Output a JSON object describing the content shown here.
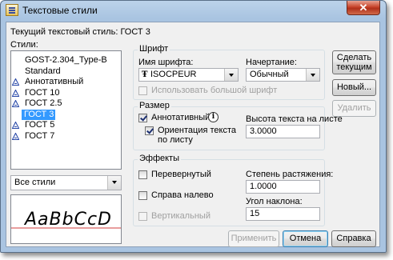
{
  "window": {
    "title": "Текстовые стили",
    "close_glyph": "✕"
  },
  "current_style": {
    "label": "Текущий текстовый стиль:",
    "value": "ГОСТ 3"
  },
  "styles": {
    "label": "Стили:",
    "items": [
      {
        "name": "GOST-2.304_Type-B",
        "annotative": false,
        "selected": false
      },
      {
        "name": "Standard",
        "annotative": false,
        "selected": false
      },
      {
        "name": "Аннотативный",
        "annotative": true,
        "selected": false
      },
      {
        "name": "ГОСТ 10",
        "annotative": true,
        "selected": false
      },
      {
        "name": "ГОСТ 2.5",
        "annotative": true,
        "selected": false
      },
      {
        "name": "ГОСТ 3",
        "annotative": true,
        "selected": true
      },
      {
        "name": "ГОСТ 5",
        "annotative": true,
        "selected": false
      },
      {
        "name": "ГОСТ 7",
        "annotative": true,
        "selected": false
      }
    ],
    "filter_value": "Все стили",
    "preview_text": "AaBbCcD"
  },
  "font": {
    "group_title": "Шрифт",
    "name_label": "Имя шрифта:",
    "name_value": "ISOCPEUR",
    "style_label": "Начертание:",
    "style_value": "Обычный",
    "bigfont_label": "Использовать большой шрифт"
  },
  "size": {
    "group_title": "Размер",
    "annotative_label": "Аннотативный",
    "orientation_label_1": "Ориентация текста",
    "orientation_label_2": "по листу",
    "height_label": "Высота текста на листе",
    "height_value": "3.0000"
  },
  "effects": {
    "group_title": "Эффекты",
    "upside_down_label": "Перевернутый",
    "backwards_label": "Справа налево",
    "vertical_label": "Вертикальный",
    "width_factor_label": "Степень растяжения:",
    "width_factor_value": "1.0000",
    "oblique_label": "Угол наклона:",
    "oblique_value": "15"
  },
  "buttons": {
    "set_current_1": "Сделать",
    "set_current_2": "текущим",
    "new": "Новый...",
    "delete": "Удалить",
    "apply": "Применить",
    "cancel": "Отмена",
    "help": "Справка"
  },
  "colors": {
    "selection": "#3399ff",
    "annotative_icon": "#2a4aa8",
    "preview_line": "#d23c3c"
  }
}
